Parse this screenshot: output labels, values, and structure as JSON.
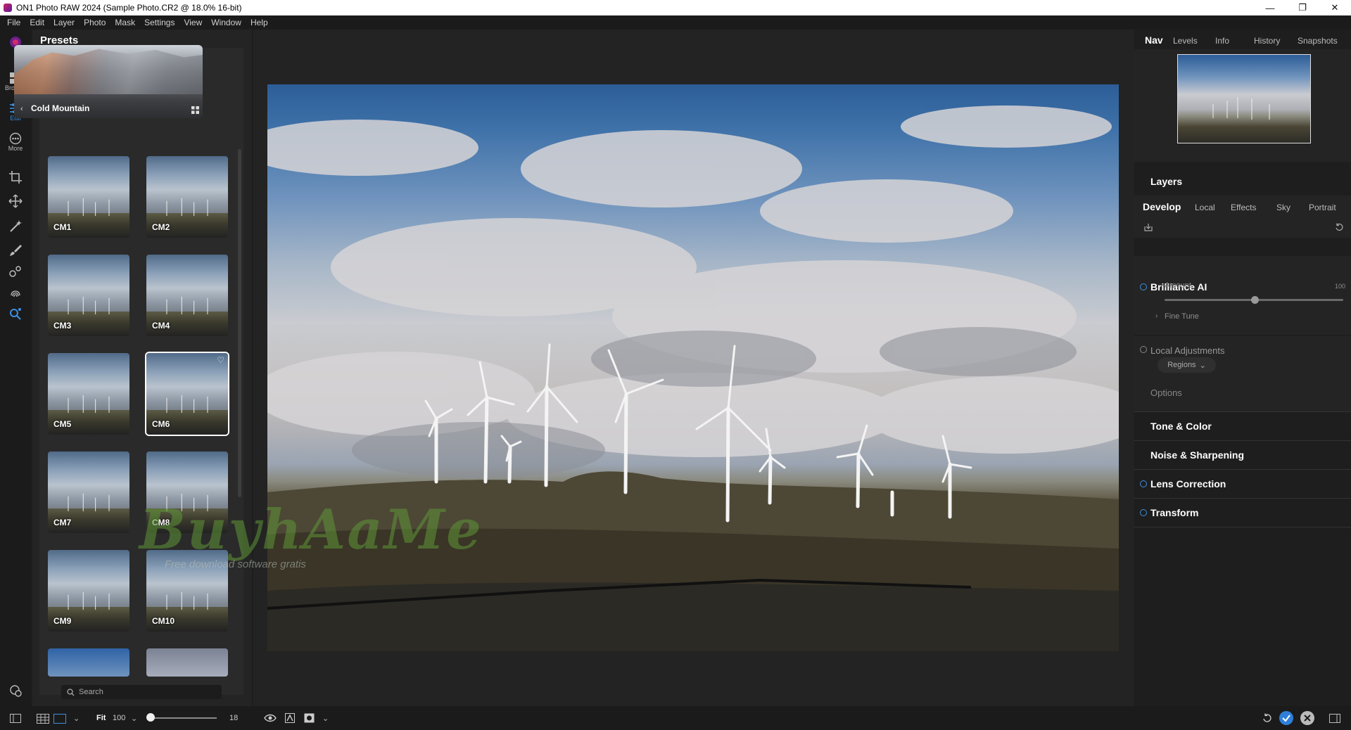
{
  "window": {
    "title": "ON1 Photo RAW 2024 (Sample Photo.CR2 @ 18.0% 16-bit)",
    "minimize": "—",
    "restore": "❐",
    "close": "✕"
  },
  "menu": [
    "File",
    "Edit",
    "Layer",
    "Photo",
    "Mask",
    "Settings",
    "View",
    "Window",
    "Help"
  ],
  "rail": {
    "browse_label": "Browse",
    "edit_label": "Edit",
    "more_label": "More"
  },
  "presets": {
    "title": "Presets",
    "category": "Cold Mountain",
    "items": [
      "CM1",
      "CM2",
      "CM3",
      "CM4",
      "CM5",
      "CM6",
      "CM7",
      "CM8",
      "CM9",
      "CM10"
    ],
    "selected": "CM6",
    "search_placeholder": "Search"
  },
  "watermark": {
    "brand": "BuyhAaMe",
    "tagline": "Free download software gratis"
  },
  "right": {
    "tabs": [
      "Nav",
      "Levels",
      "Info",
      "History",
      "Snapshots"
    ],
    "active_tab": "Nav",
    "layers_title": "Layers",
    "dev_tabs": [
      "Develop",
      "Local",
      "Effects",
      "Sky",
      "Portrait"
    ],
    "active_dev_tab": "Develop",
    "brilliance": {
      "title": "Brilliance AI",
      "amount_label": "Amount",
      "amount_value": "100",
      "fine_tune": "Fine Tune"
    },
    "local_adjustments": "Local Adjustments",
    "regions": "Regions",
    "options": "Options",
    "sections": [
      "Tone & Color",
      "Noise & Sharpening",
      "Lens Correction",
      "Transform"
    ]
  },
  "bottom": {
    "fit_label": "Fit",
    "zoom_value": "100",
    "slider_value": "18"
  },
  "colors": {
    "accent": "#3d8fe0",
    "panel": "#242424",
    "background": "#1e1e1e"
  }
}
